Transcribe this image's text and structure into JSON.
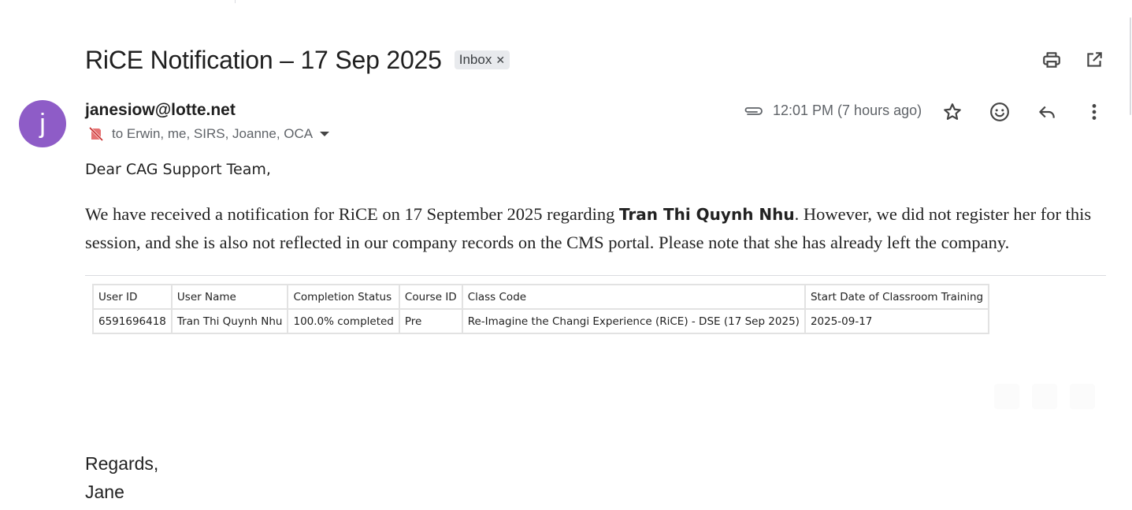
{
  "email": {
    "subject": "RiCE Notification – 17 Sep 2025",
    "label": "Inbox",
    "sender": "janesiow@lotte.net",
    "avatar_letter": "j",
    "avatar_color": "#8e5cc7",
    "recipients": "to Erwin, me, SIRS, Joanne, OCA",
    "time": "12:01 PM (7 hours ago)",
    "icons": {
      "print": "print-icon",
      "popout": "open-in-new-window-icon",
      "attachment": "paperclip-icon",
      "star": "star-icon",
      "emoji": "emoji-reaction-icon",
      "reply": "reply-icon",
      "more": "more-vertical-icon",
      "external": "external-sender-icon"
    }
  },
  "body": {
    "greeting": "Dear CAG Support Team,",
    "para_part1": "We have received a notification for RiCE on 17 September 2025 regarding ",
    "para_name": "Tran Thi Quynh Nhu",
    "para_part2": ". However, we did not register her for this session, and she is also not reflected in our company records on the CMS portal. Please note that she has already left the company.",
    "closing": "Regards,",
    "signature": "Jane"
  },
  "table": {
    "headers": [
      "User ID",
      "User Name",
      "Completion Status",
      "Course ID",
      "Class Code",
      "Start Date of Classroom Training"
    ],
    "rows": [
      [
        "6591696418",
        "Tran Thi Quynh Nhu",
        "100.0% completed",
        "Pre",
        "Re-Imagine the Changi Experience (RiCE) - DSE (17 Sep 2025)",
        "2025-09-17"
      ]
    ]
  }
}
